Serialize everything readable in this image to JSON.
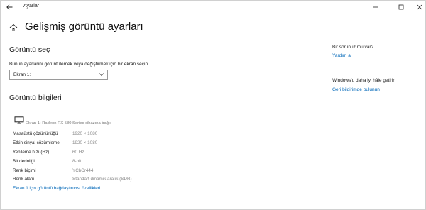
{
  "window": {
    "app_title": "Ayarlar",
    "back_icon": "back-arrow-icon",
    "controls": [
      "minimize-icon",
      "maximize-icon",
      "close-icon"
    ]
  },
  "header": {
    "home_icon": "home-icon",
    "title": "Gelişmiş görüntü ayarları"
  },
  "select_display": {
    "heading": "Görüntü seç",
    "instruction": "Bunun ayarlarını görüntülemek veya değiştirmek için bir ekran seçin.",
    "dropdown_value": "Ekran 1:"
  },
  "display_info": {
    "heading": "Görüntü bilgileri",
    "monitor_icon": "monitor-icon",
    "monitor_caption": "Ekran 1: Radeon RX 580 Series cihazına bağlı",
    "properties": [
      {
        "label": "Masaüstü çözünürlüğü",
        "value": "1920 × 1080"
      },
      {
        "label": "Etkin sinyal çözümleme",
        "value": "1920 × 1080"
      },
      {
        "label": "Yenileme hızı (Hz)",
        "value": "60 Hz"
      },
      {
        "label": "Bit derinliği",
        "value": "8-bit"
      },
      {
        "label": "Renk biçimi",
        "value": "YCbCr444"
      },
      {
        "label": "Renk alanı",
        "value": "Standart dinamik aralık (SDR)"
      }
    ],
    "adapter_link": "Ekran 1 için görüntü bağdaştırıcısı özellikleri"
  },
  "sidebar": {
    "question": "Bir sorunuz mu var?",
    "help_link": "Yardım al",
    "improve_text": "Windows'u daha iyi hâle getirin",
    "feedback_link": "Geri bildirimde bulunun"
  },
  "colors": {
    "link": "#0067b8",
    "muted": "#8a8a8a"
  }
}
